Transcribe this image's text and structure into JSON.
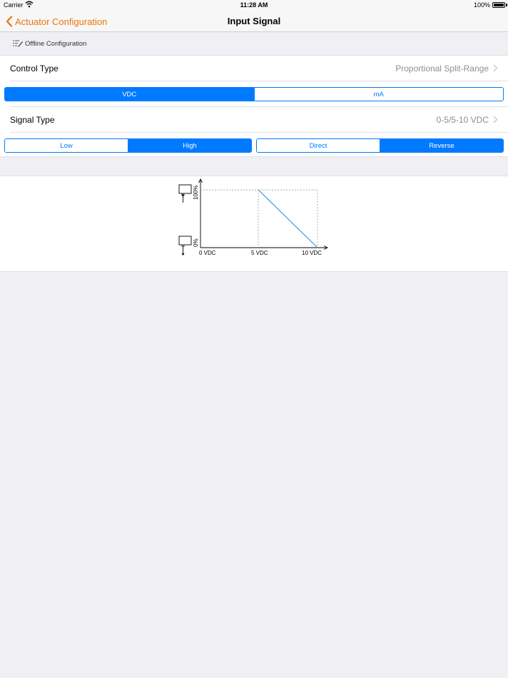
{
  "status_bar": {
    "carrier": "Carrier",
    "time": "11:28 AM",
    "battery": "100%"
  },
  "nav": {
    "back_label": "Actuator Configuration",
    "title": "Input Signal"
  },
  "offline": {
    "label": "Offline Configuration"
  },
  "control_type": {
    "label": "Control Type",
    "value": "Proportional Split-Range"
  },
  "unit_segment": {
    "options": [
      "VDC",
      "mA"
    ],
    "selected": "VDC"
  },
  "signal_type": {
    "label": "Signal Type",
    "value": "0-5/5-10 VDC"
  },
  "range_segment": {
    "options": [
      "Low",
      "High"
    ],
    "selected": "High"
  },
  "direction_segment": {
    "options": [
      "Direct",
      "Reverse"
    ],
    "selected": "Reverse"
  },
  "diagram": {
    "y_top_label": "100%",
    "y_bottom_label": "0%",
    "x_labels": [
      "0 VDC",
      "5 VDC",
      "10 VDC"
    ]
  },
  "colors": {
    "accent_orange": "#e8760c",
    "ios_blue": "#007aff",
    "line_color": "#2aa0d8"
  }
}
